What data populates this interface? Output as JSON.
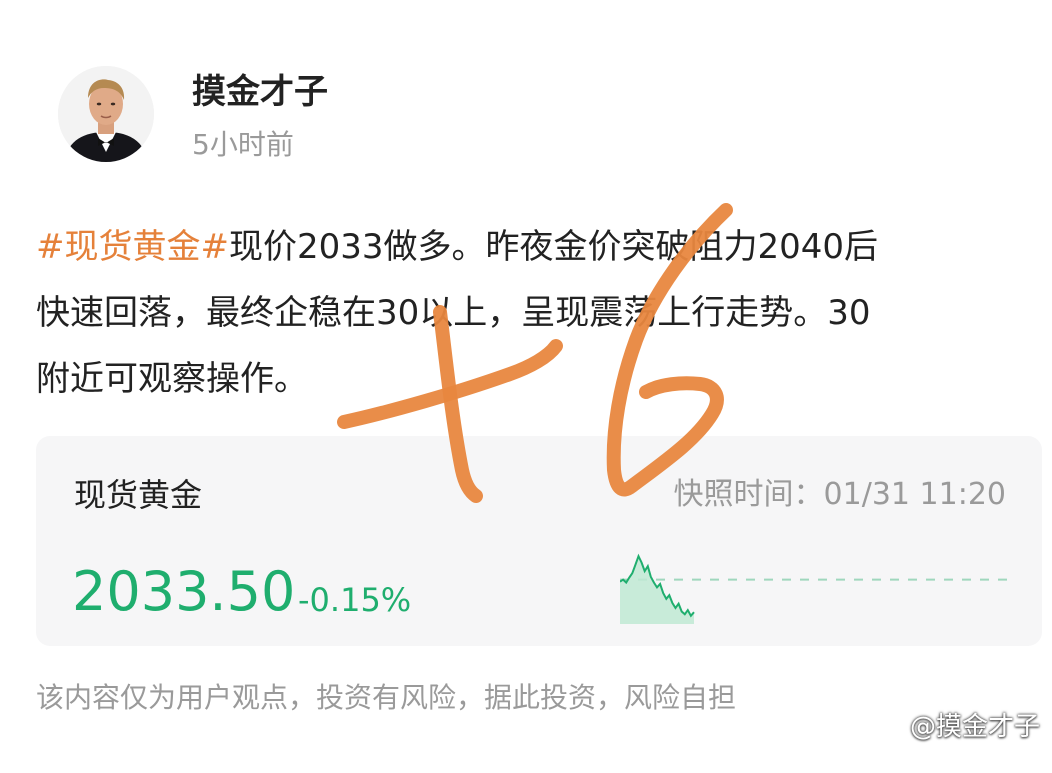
{
  "post": {
    "author_name": "摸金才子",
    "time": "5小时前",
    "hashtag": "#现货黄金#",
    "body_line1_rest": "现价2033做多。昨夜金价突破阻力2040后",
    "body_line2": "快速回落，最终企稳在30以上，呈现震荡上行走势。30",
    "body_line3": "附近可观察操作。"
  },
  "quote_card": {
    "name": "现货黄金",
    "snapshot_time": "快照时间：01/31 11:20",
    "price": "2033.50",
    "change": "-0.15%",
    "price_color": "#1fae6e",
    "sparkline_values": [
      2036.2,
      2036.5,
      2036.1,
      2036.8,
      2037.4,
      2038.6,
      2039.8,
      2038.9,
      2037.7,
      2038.4,
      2036.9,
      2036.1,
      2035.4,
      2035.9,
      2034.6,
      2033.8,
      2034.3,
      2033.2,
      2032.5,
      2033.1,
      2032.0,
      2031.6,
      2032.2,
      2031.4,
      2031.9
    ],
    "reference_level": 2036.5
  },
  "disclaimer": "该内容仅为用户观点，投资有风险，据此投资，风险自担",
  "watermark": "@摸金才子",
  "colors": {
    "hashtag": "#e5813a",
    "handwriting": "#e8873f",
    "muted_text": "#9a9a9a"
  }
}
